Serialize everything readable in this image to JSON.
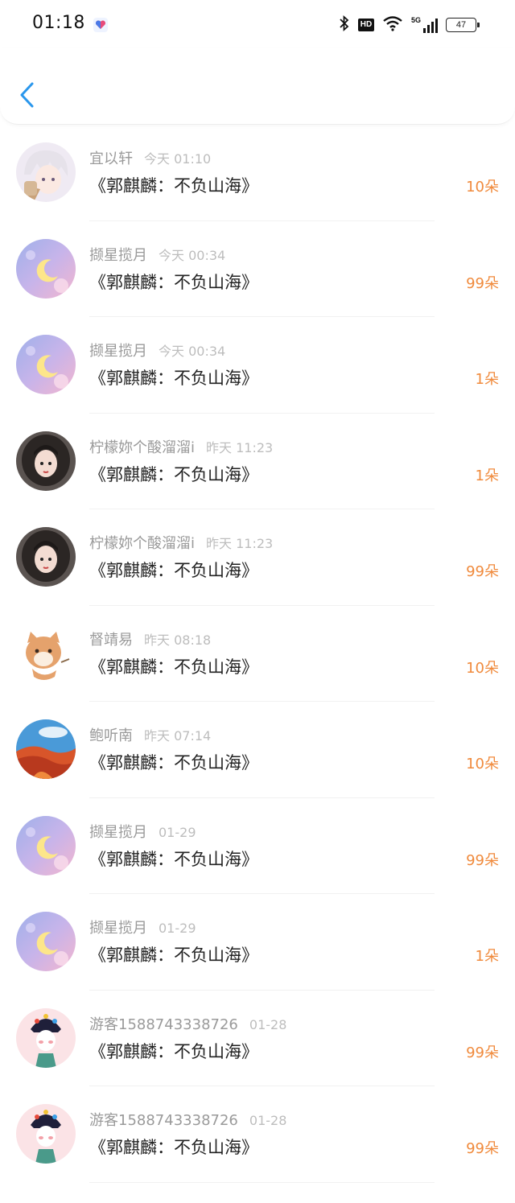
{
  "status_bar": {
    "time": "01:18",
    "network_label": "5G",
    "hd_label": "HD",
    "battery": "47"
  },
  "header": {
    "back_icon": "chevron-left-icon"
  },
  "colors": {
    "accent": "#2a97ec",
    "amount": "#f08a3c"
  },
  "rows": [
    {
      "name": "宜以轩",
      "date": "今天 01:10",
      "title": "《郭麒麟：不负山海》",
      "amount": "10朵",
      "avatar": "anime-boy-avatar"
    },
    {
      "name": "撷星揽月",
      "date": "今天 00:34",
      "title": "《郭麒麟：不负山海》",
      "amount": "99朵",
      "avatar": "moon-avatar"
    },
    {
      "name": "撷星揽月",
      "date": "今天 00:34",
      "title": "《郭麒麟：不负山海》",
      "amount": "1朵",
      "avatar": "moon-avatar"
    },
    {
      "name": "柠檬妳个酸溜溜i",
      "date": "昨天 11:23",
      "title": "《郭麒麟：不负山海》",
      "amount": "1朵",
      "avatar": "girl-avatar"
    },
    {
      "name": "柠檬妳个酸溜溜i",
      "date": "昨天 11:23",
      "title": "《郭麒麟：不负山海》",
      "amount": "99朵",
      "avatar": "girl-avatar"
    },
    {
      "name": "督靖易",
      "date": "昨天 08:18",
      "title": "《郭麒麟：不负山海》",
      "amount": "10朵",
      "avatar": "cat-avatar"
    },
    {
      "name": "鲍听南",
      "date": "昨天 07:14",
      "title": "《郭麒麟：不负山海》",
      "amount": "10朵",
      "avatar": "landscape-avatar"
    },
    {
      "name": "撷星揽月",
      "date": "01-29",
      "title": "《郭麒麟：不负山海》",
      "amount": "99朵",
      "avatar": "moon-avatar"
    },
    {
      "name": "撷星揽月",
      "date": "01-29",
      "title": "《郭麒麟：不负山海》",
      "amount": "1朵",
      "avatar": "moon-avatar"
    },
    {
      "name": "游客1588743338726",
      "date": "01-28",
      "title": "《郭麒麟：不负山海》",
      "amount": "99朵",
      "avatar": "opera-avatar"
    },
    {
      "name": "游客1588743338726",
      "date": "01-28",
      "title": "《郭麒麟：不负山海》",
      "amount": "99朵",
      "avatar": "opera-avatar"
    }
  ]
}
